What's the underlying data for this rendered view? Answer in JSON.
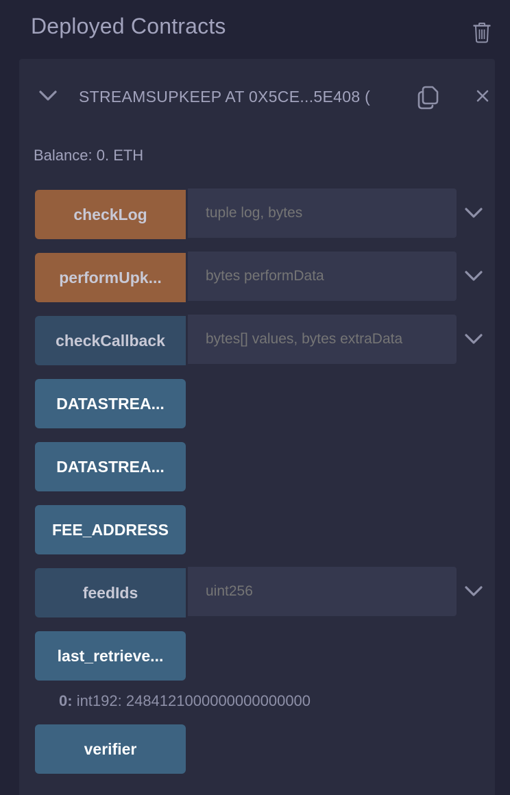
{
  "header": {
    "title": "Deployed Contracts",
    "clear_icon": "trash-icon"
  },
  "contract": {
    "name": "STREAMSUPKEEP AT 0X5CE...5E408 (",
    "balance": "Balance: 0. ETH",
    "expand_icon": "chevron-down-icon",
    "copy_icon": "copy-icon",
    "close_icon": "close-icon"
  },
  "functions": [
    {
      "label": "checkLog",
      "type": "payable",
      "placeholder": "tuple log, bytes",
      "color": "#955f3d"
    },
    {
      "label": "performUpk...",
      "type": "payable",
      "placeholder": "bytes performData",
      "color": "#955f3d"
    },
    {
      "label": "checkCallback",
      "type": "view-input",
      "placeholder": "bytes[] values, bytes extraData",
      "color": "#344c66"
    },
    {
      "label": "DATASTREA...",
      "type": "view",
      "color": "#3d6381"
    },
    {
      "label": "DATASTREA...",
      "type": "view",
      "color": "#3d6381"
    },
    {
      "label": "FEE_ADDRESS",
      "type": "view",
      "color": "#3d6381"
    },
    {
      "label": "feedIds",
      "type": "view-input",
      "placeholder": "uint256",
      "color": "#344c66"
    },
    {
      "label": "last_retrieve...",
      "type": "view",
      "color": "#3d6381"
    },
    {
      "label": "verifier",
      "type": "view",
      "color": "#3d6381"
    }
  ],
  "result": {
    "index": "0:",
    "value": "int192: 2484121000000000000000"
  }
}
